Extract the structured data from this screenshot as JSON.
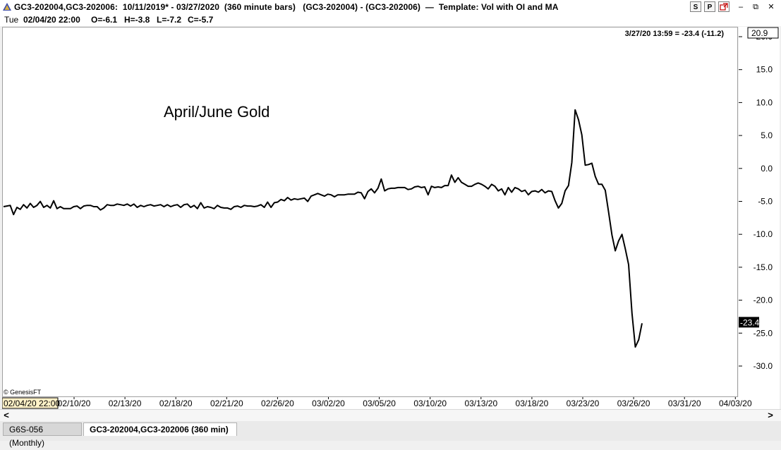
{
  "window": {
    "title": "GC3-202004,GC3-202006:  10/11/2019* - 03/27/2020  (360 minute bars)   (GC3-202004) - (GC3-202006)  —  Template: Vol with OI and MA",
    "buttons": {
      "s": "S",
      "p": "P"
    },
    "controls": {
      "minimize": "–",
      "restore": "⧉",
      "close": "✕"
    }
  },
  "info": {
    "day": "Tue",
    "datetime": "02/04/20 22:00",
    "open": "O=-6.1",
    "high": "H=-3.8",
    "low": "L=-7.2",
    "close": "C=-5.7"
  },
  "chart": {
    "readout": "3/27/20 13:59 = -23.4 (-11.2)",
    "annotation": "April/June Gold",
    "copyright": "© GenesisFT",
    "cursor_date": "02/04/20 22:00",
    "price_marker": "-23.4",
    "scale_marker": "20.9"
  },
  "chart_data": {
    "type": "line",
    "title": "April/June Gold",
    "ylim": [
      -34.5,
      21.5
    ],
    "yticks": [
      20.0,
      15.0,
      10.0,
      5.0,
      0.0,
      -5.0,
      -10.0,
      -15.0,
      -20.0,
      -25.0,
      -30.0
    ],
    "ytick_labels": [
      "20.0",
      "15.0",
      "10.0",
      "5.0",
      "0.0",
      "-5.0",
      "-10.0",
      "-15.0",
      "-20.0",
      "-25.0",
      "-30.0"
    ],
    "xtick_labels": [
      "02/10/20",
      "02/13/20",
      "02/18/20",
      "02/21/20",
      "02/26/20",
      "03/02/20",
      "03/05/20",
      "03/10/20",
      "03/13/20",
      "03/18/20",
      "03/23/20",
      "03/26/20",
      "03/31/20",
      "04/03/20"
    ],
    "series": [
      {
        "values": [
          -5.7,
          -5.6,
          -5.5,
          -6.9,
          -5.8,
          -6.1,
          -5.4,
          -5.9,
          -5.2,
          -5.8,
          -5.5,
          -4.9,
          -5.8,
          -5.5,
          -5.9,
          -4.8,
          -6.0,
          -5.7,
          -6.0,
          -6.0,
          -6.0,
          -5.7,
          -5.6,
          -6.0,
          -5.6,
          -5.5,
          -5.5,
          -5.7,
          -5.7,
          -6.2,
          -5.9,
          -5.4,
          -5.5,
          -5.5,
          -5.3,
          -5.4,
          -5.5,
          -5.3,
          -5.6,
          -5.3,
          -5.8,
          -5.5,
          -5.7,
          -5.5,
          -5.4,
          -5.6,
          -5.5,
          -5.4,
          -5.7,
          -5.4,
          -5.7,
          -5.5,
          -5.4,
          -5.8,
          -5.4,
          -5.3,
          -5.8,
          -5.5,
          -6.0,
          -5.1,
          -5.9,
          -5.7,
          -5.8,
          -6.0,
          -5.5,
          -5.8,
          -5.9,
          -5.9,
          -6.1,
          -5.7,
          -5.6,
          -5.8,
          -5.5,
          -5.6,
          -5.6,
          -5.7,
          -5.6,
          -5.4,
          -5.8,
          -5.0,
          -5.8,
          -5.1,
          -5.0,
          -4.6,
          -4.8,
          -4.3,
          -4.7,
          -4.5,
          -4.6,
          -4.5,
          -4.4,
          -4.9,
          -4.1,
          -3.9,
          -3.7,
          -3.9,
          -4.1,
          -3.8,
          -3.9,
          -4.2,
          -3.9,
          -3.9,
          -3.9,
          -3.8,
          -3.8,
          -3.8,
          -3.5,
          -3.6,
          -4.5,
          -3.4,
          -3.0,
          -3.6,
          -2.9,
          -1.5,
          -3.3,
          -3.0,
          -2.9,
          -2.9,
          -2.8,
          -2.8,
          -2.8,
          -3.1,
          -3.0,
          -2.7,
          -2.6,
          -2.8,
          -2.7,
          -3.9,
          -2.6,
          -2.8,
          -2.7,
          -2.8,
          -2.5,
          -2.5,
          -0.9,
          -2.0,
          -1.3,
          -2.0,
          -2.3,
          -2.6,
          -2.6,
          -2.3,
          -2.1,
          -2.3,
          -2.6,
          -3.0,
          -2.3,
          -2.6,
          -3.3,
          -3.0,
          -3.9,
          -2.8,
          -3.5,
          -2.8,
          -3.0,
          -3.4,
          -3.2,
          -3.9,
          -3.4,
          -3.3,
          -3.5,
          -3.1,
          -3.6,
          -3.3,
          -3.4,
          -4.8,
          -5.9,
          -5.2,
          -3.3,
          -2.5,
          1.0,
          9.0,
          7.5,
          5.2,
          0.6,
          0.7,
          0.9,
          -1.1,
          -2.3,
          -2.3,
          -3.2,
          -6.5,
          -10.0,
          -12.4,
          -10.9,
          -9.9,
          -12.1,
          -14.5,
          -21.9,
          -27.0,
          -25.9,
          -23.4
        ]
      }
    ]
  },
  "tabs": [
    {
      "label": "G6S-056 (Monthly)"
    },
    {
      "label": "GC3-202004,GC3-202006 (360 min)"
    }
  ],
  "scroll": {
    "left": "<",
    "right": ">"
  }
}
